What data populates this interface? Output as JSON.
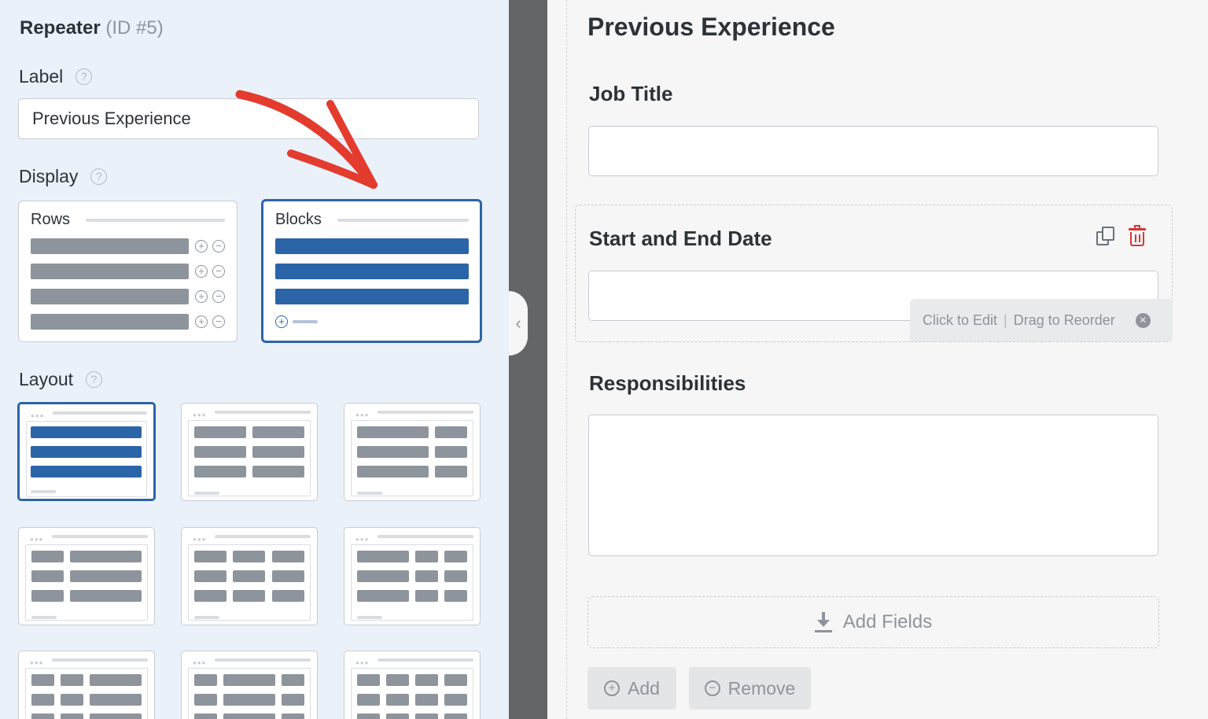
{
  "sidebar": {
    "title": "Repeater",
    "id_text": "(ID #5)",
    "label_heading": "Label",
    "label_value": "Previous Experience",
    "display_heading": "Display",
    "display_options": [
      {
        "label": "Rows",
        "selected": false
      },
      {
        "label": "Blocks",
        "selected": true
      }
    ],
    "layout_heading": "Layout",
    "help_icon": "question-circle-icon"
  },
  "form": {
    "title": "Previous Experience",
    "fields": [
      {
        "label": "Job Title"
      },
      {
        "label": "Start and End Date"
      },
      {
        "label": "Responsibilities"
      }
    ],
    "tooltip": {
      "edit_text": "Click to Edit",
      "separator": "|",
      "reorder_text": "Drag to Reorder"
    },
    "add_fields_label": "Add Fields",
    "add_button": "Add",
    "remove_button": "Remove"
  },
  "colors": {
    "accent": "#2c64a8",
    "danger": "#d63638",
    "annotation_arrow": "#e33b2e"
  }
}
